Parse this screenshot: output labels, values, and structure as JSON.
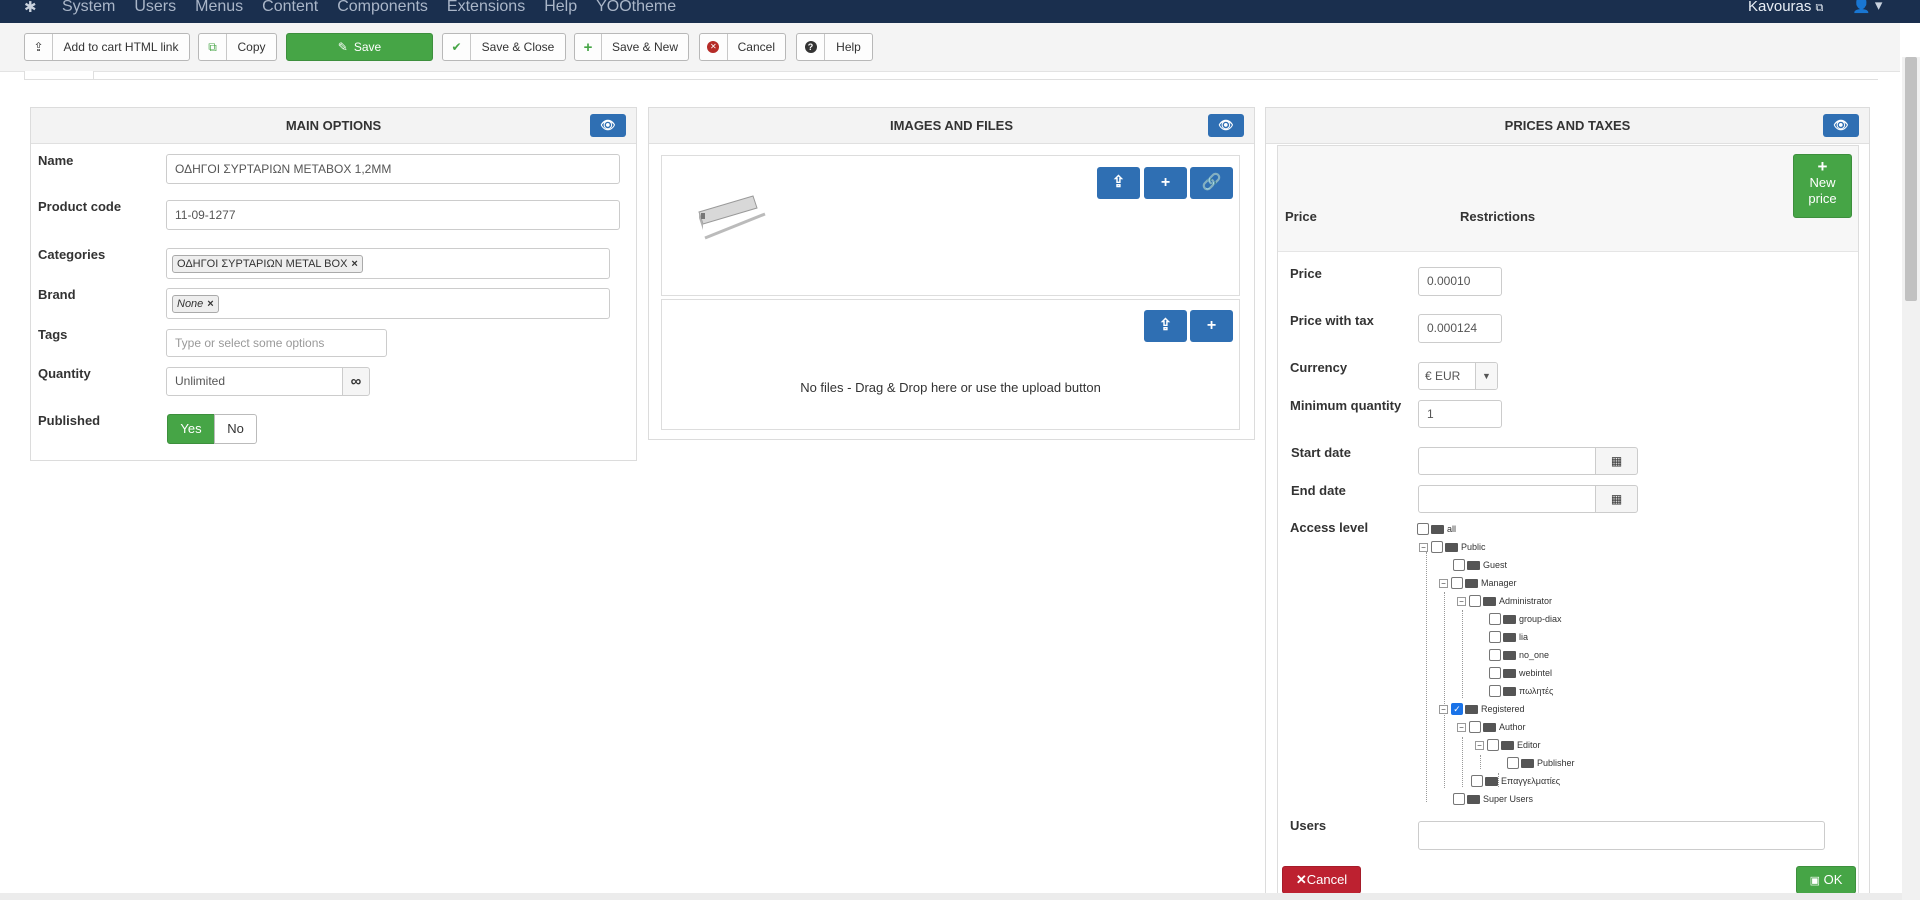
{
  "topbar": {
    "menu": [
      "System",
      "Users",
      "Menus",
      "Content",
      "Components",
      "Extensions",
      "Help",
      "YOOtheme"
    ],
    "site_name": "Kavouras",
    "site_icon": "external-link-icon",
    "user_icon": "user-icon"
  },
  "toolbar": {
    "add_to_cart": "Add to cart HTML link",
    "copy": "Copy",
    "save": "Save",
    "save_close": "Save & Close",
    "save_new": "Save & New",
    "cancel": "Cancel",
    "help": "Help"
  },
  "main_options": {
    "title": "MAIN OPTIONS",
    "name_label": "Name",
    "name_value": "ΟΔΗΓΟΙ ΣΥΡΤΑΡΙΩΝ METABOX 1,2MM",
    "code_label": "Product code",
    "code_value": "11-09-1277",
    "categories_label": "Categories",
    "category_chip": "ΟΔΗΓΟΙ ΣΥΡΤΑΡΙΩΝ METAL BOX",
    "brand_label": "Brand",
    "brand_chip": "None",
    "tags_label": "Tags",
    "tags_placeholder": "Type or select some options",
    "quantity_label": "Quantity",
    "quantity_value": "Unlimited",
    "published_label": "Published",
    "yes": "Yes",
    "no": "No"
  },
  "images": {
    "title": "IMAGES AND FILES",
    "no_files": "No files - Drag & Drop here or use the upload button"
  },
  "prices": {
    "title": "PRICES AND TAXES",
    "col_price": "Price",
    "col_restrictions": "Restrictions",
    "new_price": "New price",
    "price_label": "Price",
    "price_value": "0.00010",
    "price_tax_label": "Price with tax",
    "price_tax_value": "0.000124",
    "currency_label": "Currency",
    "currency_value": "€ EUR",
    "min_qty_label": "Minimum quantity",
    "min_qty_value": "1",
    "start_label": "Start date",
    "end_label": "End date",
    "access_label": "Access level",
    "users_label": "Users",
    "cancel": "Cancel",
    "ok": "OK"
  },
  "access_tree": [
    {
      "label": "all",
      "checked": false
    },
    {
      "label": "Public",
      "checked": false
    },
    {
      "label": "Guest",
      "checked": false
    },
    {
      "label": "Manager",
      "checked": false
    },
    {
      "label": "Administrator",
      "checked": false
    },
    {
      "label": "group-diax",
      "checked": false
    },
    {
      "label": "lia",
      "checked": false
    },
    {
      "label": "no_one",
      "checked": false
    },
    {
      "label": "webintel",
      "checked": false
    },
    {
      "label": "πωλητές",
      "checked": false
    },
    {
      "label": "Registered",
      "checked": true
    },
    {
      "label": "Author",
      "checked": false
    },
    {
      "label": "Editor",
      "checked": false
    },
    {
      "label": "Publisher",
      "checked": false
    },
    {
      "label": "Επαγγελματίες",
      "checked": false
    },
    {
      "label": "Super Users",
      "checked": false
    }
  ]
}
